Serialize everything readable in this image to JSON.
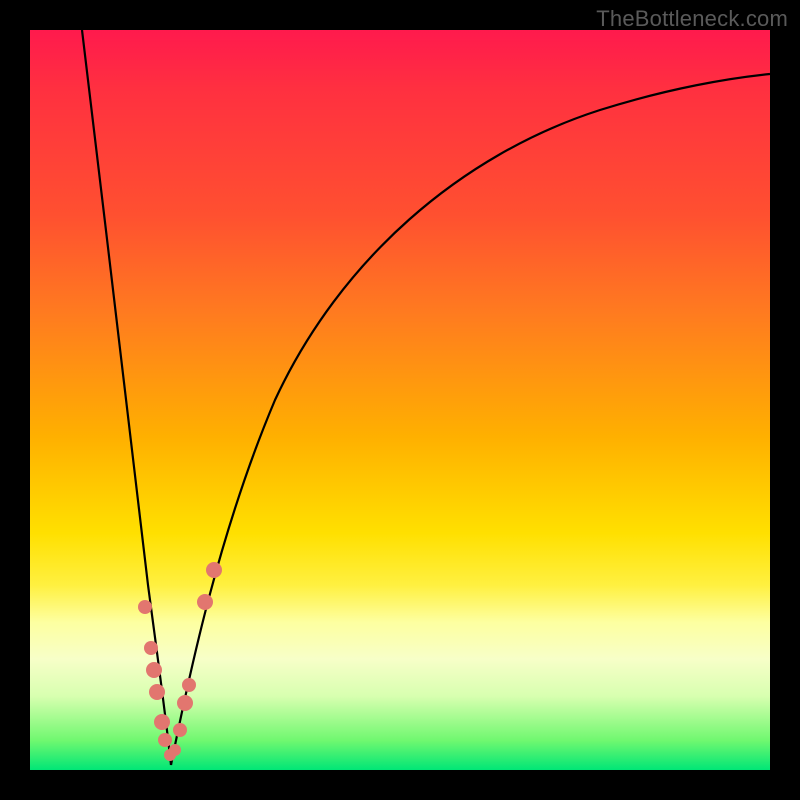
{
  "watermark": "TheBottleneck.com",
  "chart_data": {
    "type": "line",
    "title": "",
    "xlabel": "",
    "ylabel": "",
    "xlim": [
      0,
      100
    ],
    "ylim": [
      0,
      100
    ],
    "grid": false,
    "background_gradient": {
      "top": "#ff1a4d",
      "bottom": "#00e676"
    },
    "curve_color": "#000000",
    "marker_color": "#e2766f",
    "series": [
      {
        "name": "left-branch",
        "x": [
          7,
          8,
          9,
          10,
          11,
          12,
          13,
          14,
          15,
          16,
          17,
          18,
          19
        ],
        "y": [
          100,
          91,
          82,
          73,
          64,
          55,
          46,
          37,
          29,
          21,
          14,
          7,
          0
        ]
      },
      {
        "name": "right-branch",
        "x": [
          19,
          20,
          21,
          22,
          23,
          25,
          27,
          30,
          34,
          40,
          48,
          58,
          70,
          84,
          100
        ],
        "y": [
          0,
          5,
          10,
          15,
          20,
          28,
          35,
          44,
          53,
          62,
          70,
          77,
          83,
          88,
          92
        ]
      }
    ],
    "markers_left": [
      {
        "x": 15.5,
        "y": 22
      },
      {
        "x": 16.3,
        "y": 16
      },
      {
        "x": 16.8,
        "y": 13
      },
      {
        "x": 17.2,
        "y": 10
      },
      {
        "x": 17.8,
        "y": 6
      },
      {
        "x": 18.3,
        "y": 3.8
      },
      {
        "x": 18.9,
        "y": 1.8
      }
    ],
    "markers_right": [
      {
        "x": 19.6,
        "y": 2.6
      },
      {
        "x": 20.2,
        "y": 5.2
      },
      {
        "x": 21.0,
        "y": 9.0
      },
      {
        "x": 21.5,
        "y": 11.5
      },
      {
        "x": 23.6,
        "y": 22.5
      },
      {
        "x": 24.8,
        "y": 27.0
      }
    ],
    "minimum": {
      "x": 19,
      "y": 0
    }
  }
}
